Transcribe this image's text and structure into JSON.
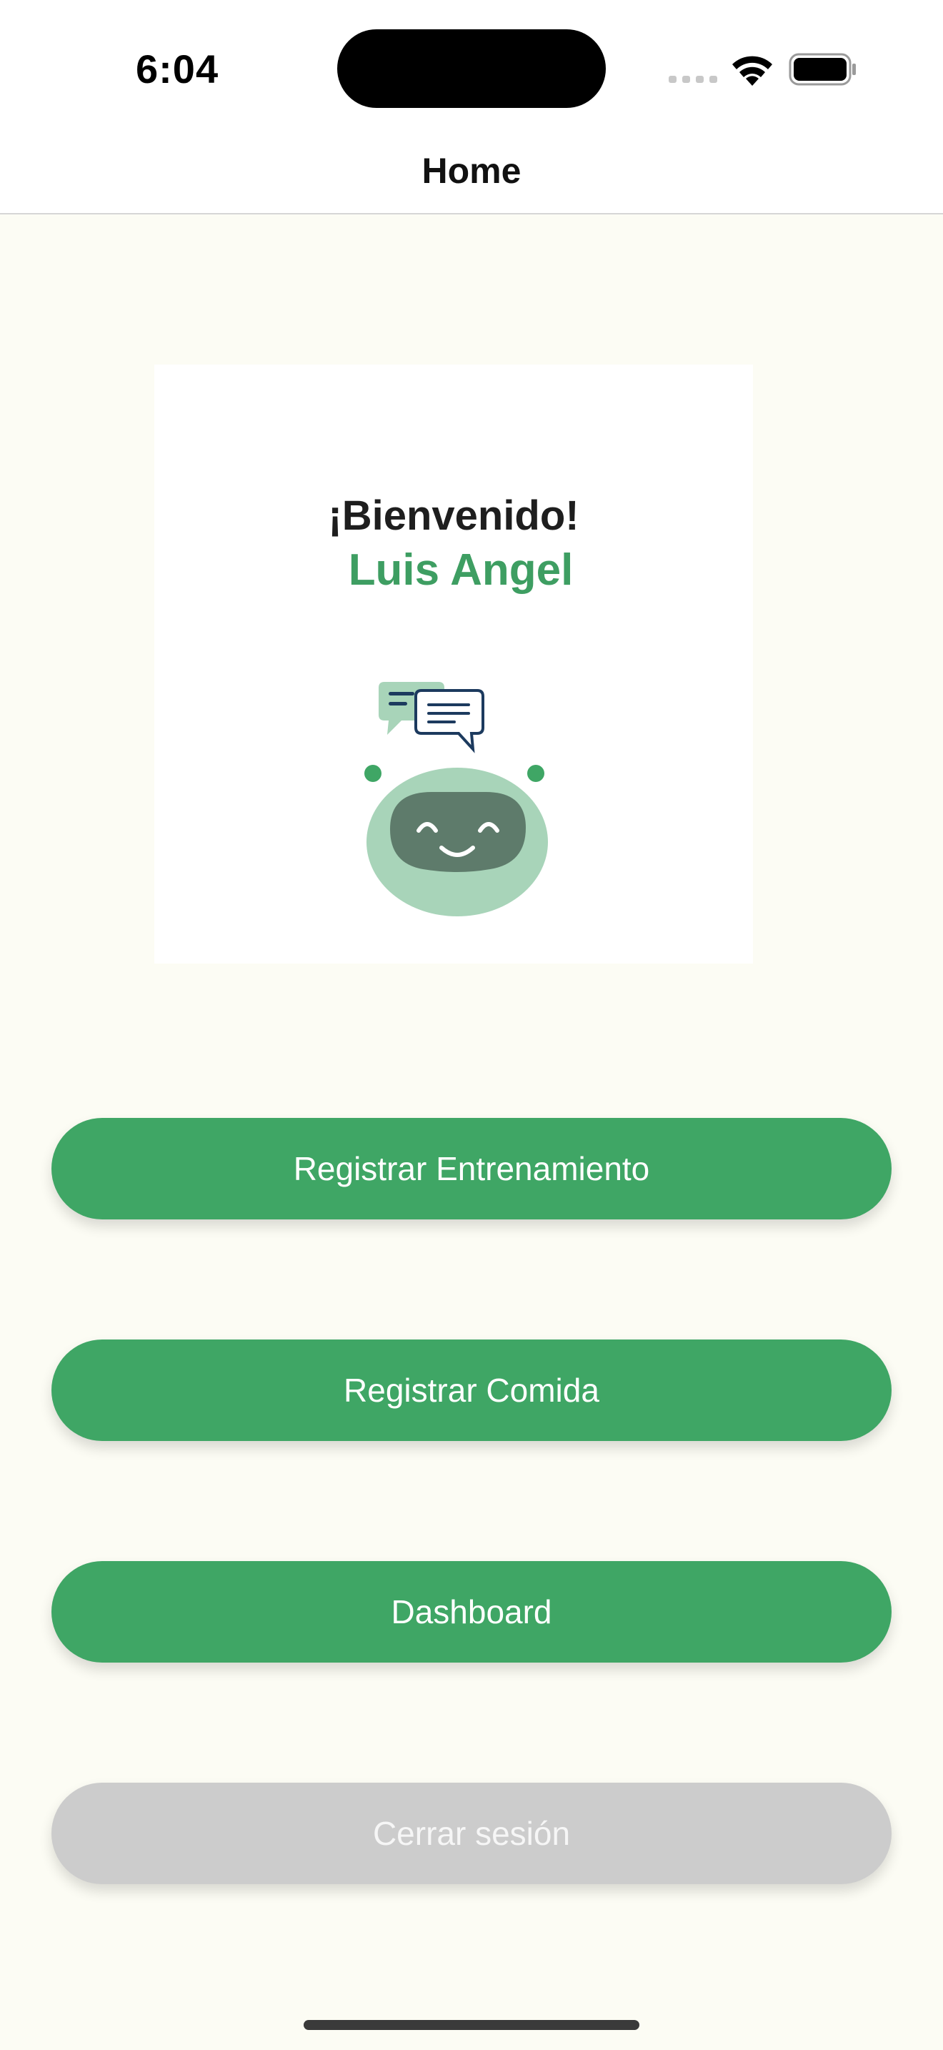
{
  "status_bar": {
    "time": "6:04",
    "icons": [
      "signal-icon",
      "wifi-icon",
      "battery-icon"
    ]
  },
  "nav": {
    "title": "Home"
  },
  "welcome": {
    "greeting": "¡Bienvenido!",
    "user_name": "Luis Angel",
    "mascot_icon": "chatbot-mascot-icon"
  },
  "actions": {
    "register_training": "Registrar Entrenamiento",
    "register_meal": "Registrar Comida",
    "dashboard": "Dashboard",
    "logout": "Cerrar sesión"
  },
  "colors": {
    "background": "#FCFCF4",
    "primary_green": "#3FA665",
    "disabled_gray": "#CCCCCC",
    "name_green": "#3E9E62"
  }
}
